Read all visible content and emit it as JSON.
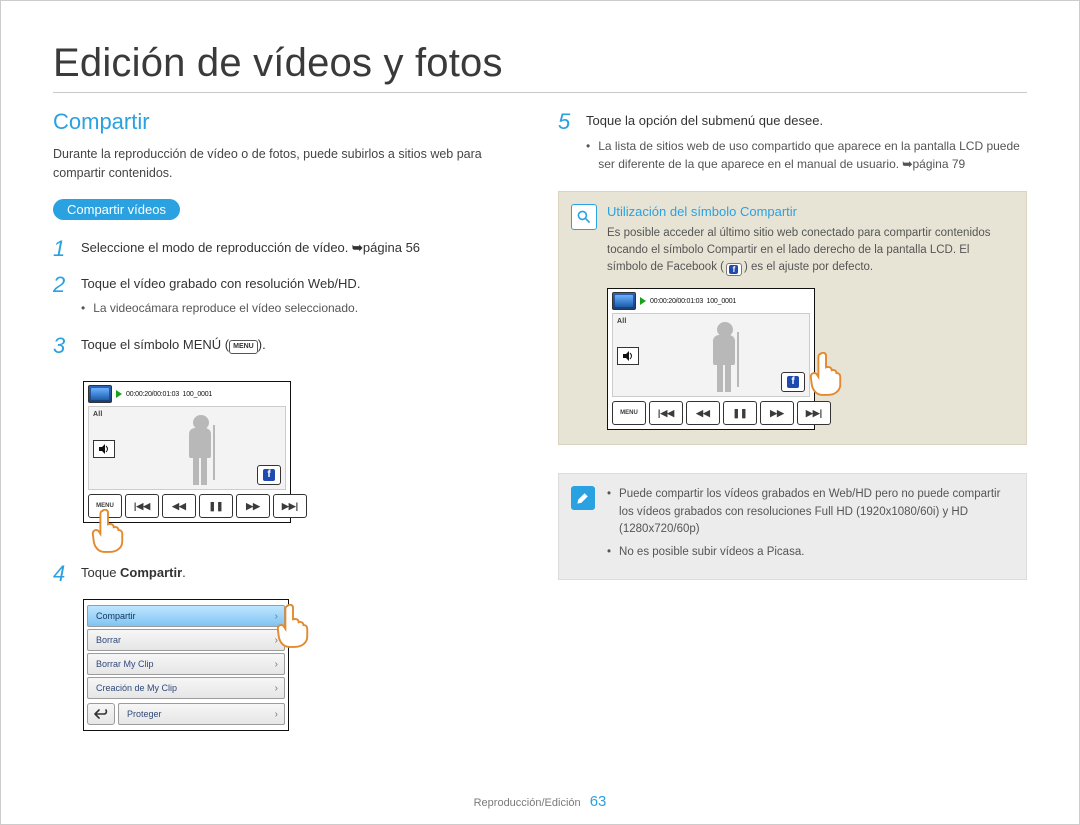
{
  "page": {
    "title": "Edición de vídeos y fotos"
  },
  "section": {
    "title": "Compartir"
  },
  "intro": "Durante la reproducción de vídeo o de fotos, puede subirlos a sitios web para compartir contenidos.",
  "pill": "Compartir vídeos",
  "steps": {
    "s1": {
      "num": "1",
      "text": "Seleccione el modo de reproducción de vídeo. ",
      "arrow": "➥",
      "page_ref": "página 56"
    },
    "s2": {
      "num": "2",
      "text": "Toque el vídeo grabado con resolución Web/HD.",
      "bullet": "La videocámara reproduce el vídeo seleccionado."
    },
    "s3": {
      "num": "3",
      "text_pre": "Toque el símbolo MENÚ (",
      "menu_label": "MENU",
      "text_post": ")."
    },
    "s4": {
      "num": "4",
      "text_pre": "Toque ",
      "bold": "Compartir",
      "text_post": "."
    },
    "s5": {
      "num": "5",
      "text": "Toque la opción del submenú que desee.",
      "bullet": "La lista de sitios web de uso compartido que aparece en la pantalla LCD puede ser diferente de la que aparece en el manual de usuario.",
      "arrow": "➥",
      "page_ref": "página 79"
    }
  },
  "player": {
    "time": "00:00:20/00:01:03",
    "file": "100_0001",
    "all": "All",
    "menu": "MENU",
    "fb": "f",
    "controls": {
      "prev": "|◀◀",
      "rew": "◀◀",
      "pause": "❚❚",
      "fwd": "▶▶",
      "next": "▶▶|"
    },
    "sound_icon": "sound-icon"
  },
  "menu_list": {
    "i0": "Compartir",
    "i1": "Borrar",
    "i2": "Borrar My Clip",
    "i3": "Creación de My Clip",
    "i4": "Proteger",
    "back": "↩"
  },
  "note": {
    "title": "Utilización del símbolo Compartir",
    "body_pre": "Es posible acceder al último sitio web conectado para compartir contenidos tocando el símbolo Compartir en el lado derecho de la pantalla LCD. El símbolo de Facebook (",
    "body_post": ") es el ajuste por defecto."
  },
  "note2": {
    "b1": "Puede compartir los vídeos grabados en Web/HD pero no puede compartir los vídeos grabados con resoluciones Full HD (1920x1080/60i) y HD (1280x720/60p)",
    "b2": "No es posible subir vídeos a Picasa."
  },
  "footer": {
    "section": "Reproducción/Edición",
    "page": "63"
  }
}
